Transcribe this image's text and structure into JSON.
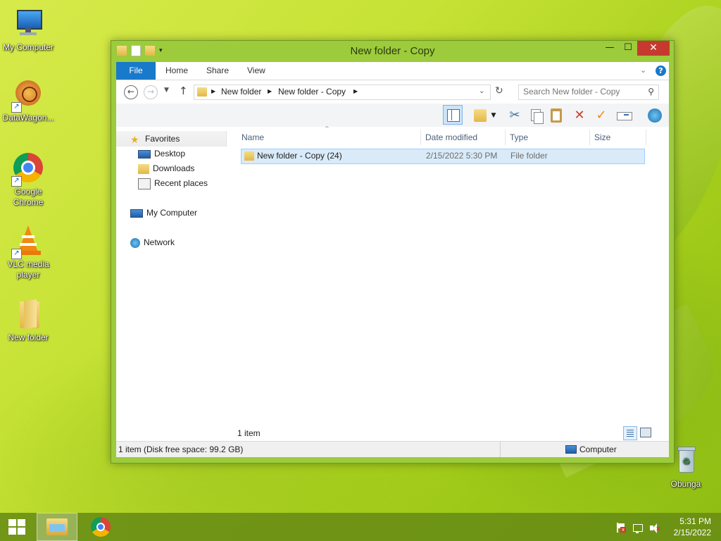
{
  "desktop": {
    "icons": [
      {
        "label": "My Computer"
      },
      {
        "label": "DataWagon..."
      },
      {
        "label": "Google Chrome"
      },
      {
        "label": "VLC media player"
      },
      {
        "label": "New folder"
      },
      {
        "label": "Obunga"
      }
    ]
  },
  "window": {
    "title": "New folder - Copy",
    "minimize": "—",
    "maximize": "☐",
    "close": "✕"
  },
  "ribbon": {
    "tabs": [
      "File",
      "Home",
      "Share",
      "View"
    ]
  },
  "address": {
    "crumbs": [
      "New folder",
      "New folder - Copy"
    ],
    "search_placeholder": "Search New folder - Copy"
  },
  "nav": {
    "favorites": "Favorites",
    "desktop": "Desktop",
    "downloads": "Downloads",
    "recent": "Recent places",
    "computer": "My Computer",
    "network": "Network"
  },
  "list": {
    "columns": [
      "Name",
      "Date modified",
      "Type",
      "Size"
    ],
    "rows": [
      {
        "name": "New folder - Copy (24)",
        "date": "2/15/2022 5:30 PM",
        "type": "File folder",
        "size": ""
      }
    ],
    "count": "1 item"
  },
  "statusbar": {
    "left": "1 item (Disk free space: 99.2 GB)",
    "right": "Computer"
  },
  "taskbar": {
    "time": "5:31 PM",
    "date": "2/15/2022"
  },
  "colors": {
    "accent": "#1979ca",
    "close": "#c7392f",
    "selection": "#d9ebf9"
  }
}
